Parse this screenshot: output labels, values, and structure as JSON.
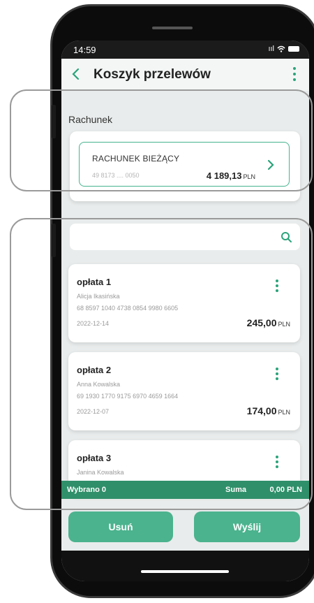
{
  "status": {
    "time": "14:59",
    "signal": "ııl"
  },
  "header": {
    "title": "Koszyk przelewów"
  },
  "account": {
    "section_label": "Rachunek",
    "name": "RACHUNEK BIEŻĄCY",
    "number": "49 8173 .... 0050",
    "balance": "4 189,13",
    "currency": "PLN"
  },
  "transfers": [
    {
      "name": "opłata 1",
      "recipient": "Alicja Ikasińska",
      "iban": "68 8597 1040 4738 0854 9980 6605",
      "date": "2022-12-14",
      "amount": "245,00",
      "currency": "PLN"
    },
    {
      "name": "opłata 2",
      "recipient": "Anna Kowalska",
      "iban": "69 1930 1770 9175 6970 4659 1664",
      "date": "2022-12-07",
      "amount": "174,00",
      "currency": "PLN"
    },
    {
      "name": "opłata 3",
      "recipient": "Janina Kowalska"
    }
  ],
  "summary": {
    "selected": "Wybrano 0",
    "sum_label": "Suma",
    "sum_value": "0,00 PLN"
  },
  "actions": {
    "delete_label": "Usuń",
    "send_label": "Wyślij"
  },
  "colors": {
    "accent": "#2aa37a",
    "summary_bar": "#2f8f6a",
    "button": "#4bb38e"
  },
  "icons": [
    "back-arrow-icon",
    "more-vertical-icon",
    "chevron-right-icon",
    "search-icon",
    "signal-icon",
    "wifi-icon",
    "battery-icon"
  ]
}
